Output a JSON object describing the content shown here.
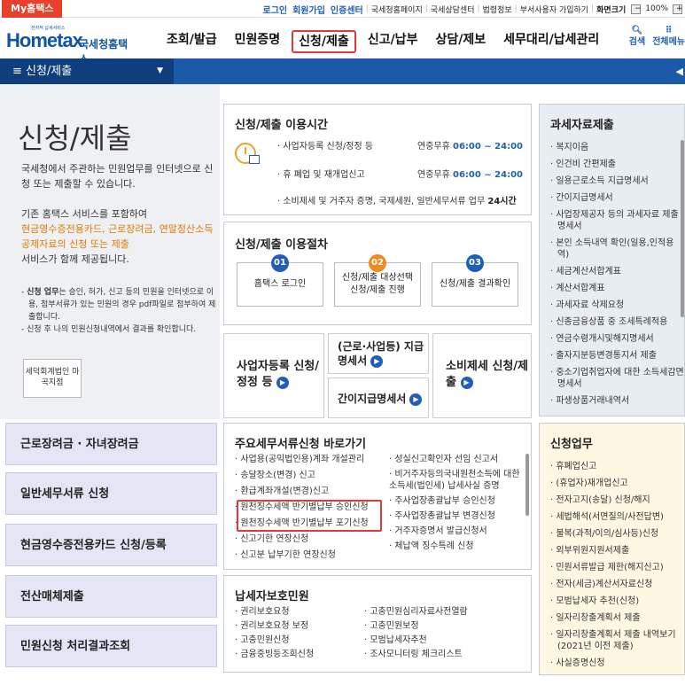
{
  "topbar": {
    "badge": "My홈택스",
    "login": "로그인",
    "join": "회원가입",
    "cert": "인증센터",
    "links": [
      "국세청홈페이지",
      "국세상담센터",
      "법령정보",
      "부서사용자 가입하기"
    ],
    "zoom_label": "화면크기",
    "zoom_value": "100%"
  },
  "header": {
    "logo_small": "전자적 납세서비스",
    "logo_main": "Hometax",
    "logo_kr": "국세청홈택스",
    "menu": [
      "조회/발급",
      "민원증명",
      "신청/제출",
      "신고/납부",
      "상담/제보",
      "세무대리/납세관리"
    ],
    "search_label": "검색",
    "allmenu_label": "전체메뉴"
  },
  "navbar": {
    "selected": "≡  신청/제출"
  },
  "left": {
    "title": "신청/제출",
    "intro": "국세청에서 주관하는 민원업무를 인터넷으로 신청 또는 제출할 수 있습니다.",
    "intro2_a": "기존 홈택스 서비스를 포함하여",
    "intro2_hl": "현금영수증전용카드, 근로장려금, 연말정산소득공제자료의 신청 또는 제출",
    "intro2_b": "서비스가 함께 제공됩니다.",
    "note1_bold": "신청 업무",
    "note1": "는 승인, 허가, 신고 등의 민원을 인터넷으로 이용, 첨부서류가 있는 민원의 경우 pdf파일로 첨부하여 제출합니다.",
    "note2": "신청 후 나의 민원신청내역에서 결과를 확인합니다.",
    "sejong": "세덕회계법인 마곡지점"
  },
  "usage_time": {
    "title": "신청/제출 이용시간",
    "rows": [
      {
        "label": "· 사업자등록 신청/정정 등",
        "when": "연중무휴",
        "time": "06:00 ~ 24:00"
      },
      {
        "label": "· 휴 폐업 및 재개업신고",
        "when": "연중무휴",
        "time": "06:00 ~ 24:00"
      },
      {
        "label": "· 소비제세 및 거주자 증명, 국제세원, 일반세무서류 업무",
        "when": "",
        "time": "24시간"
      }
    ]
  },
  "procedure": {
    "title": "신청/제출 이용절차",
    "steps": [
      {
        "num": "01",
        "label": "홈택스 로그인",
        "color": "#1f5fb8"
      },
      {
        "num": "02",
        "label": "신청/제출 대상선택 신청/제출 진행",
        "color": "#f08a1f"
      },
      {
        "num": "03",
        "label": "신청/제출 결과확인",
        "color": "#1f5fb8"
      }
    ]
  },
  "quick": {
    "biz": "사업자등록 신청/정정 등",
    "withhold": "(근로·사업등) 지급명세서",
    "simple": "간이지급명세서",
    "consume": "소비제세 신청/제출"
  },
  "tax_data": {
    "title": "과세자료제출",
    "items": [
      "복지이음",
      "인건비 간편제출",
      "일용근로소득 지급명세서",
      "간이지급명세서",
      "사업장제공자 등의 과세자료 제출명세서",
      "본인 소득내역 확인(일용,인적용역)",
      "세금계산서합계표",
      "계산서합계표",
      "과세자료 삭제요청",
      "신종금융상품 중 조세특례적용",
      "연금수령개시및해지명세서",
      "출자지분등변경통지서 제출",
      "중소기업취업자에 대한 소득세감면명세서",
      "파생상품거래내역서"
    ]
  },
  "left_buttons": [
    "근로장려금 · 자녀장려금",
    "일반세무서류 신청",
    "현금영수증전용카드 신청/등록",
    "전산매체제출",
    "민원신청 처리결과조회"
  ],
  "major": {
    "title": "주요세무서류신청 바로가기",
    "col1": [
      "사업용(공익법인용)계좌 개설관리",
      "송달장소(변경) 신고",
      "환급계좌개설(변경)신고",
      "원천징수세액 반기별납부 승인신청",
      "원천징수세액 반기별납부 포기신청",
      "신고기한 연장신청",
      "신고분 납부기한 연장신청"
    ],
    "col2": [
      "성실신고확인자 선임 신고서",
      "비거주자등의국내원천소득에 대한 소득세(법인세) 납세사실 증명",
      "주사업장총괄납부 승인신청",
      "주사업장총괄납부 변경신청",
      "거주자증명서 발급신청서",
      "체납액 징수특례 신청"
    ]
  },
  "protect": {
    "title": "납세자보호민원",
    "col1": [
      "권리보호요청",
      "권리보호요청 보정",
      "고충민원신청",
      "금융중빙등조회신청"
    ],
    "col2": [
      "고충민원심리자료사전열람",
      "고충민원보정",
      "모범납세자추천",
      "조사모니터링 체크리스트"
    ]
  },
  "apply": {
    "title": "신청업무",
    "items": [
      "휴폐업신고",
      "(휴업자)재개업신고",
      "전자고지(송달) 신청/해지",
      "세법해석(서면질의/사전답변)",
      "불복(과적/이의/심사등)신청",
      "외부위원지원서제출",
      "민원서류발급 제한(해지신고)",
      "전자(세금)계산서자료신청",
      "모범납세자 추천(신청)",
      "일자리창출계획서 제출",
      "일자리창출계획서 제출 내역보기 (2021년 이전 제출)",
      "사실증명신청"
    ]
  },
  "colors": {
    "brand": "#1f5fb8",
    "nav": "#1b5aa8",
    "highlight": "#e53935"
  }
}
